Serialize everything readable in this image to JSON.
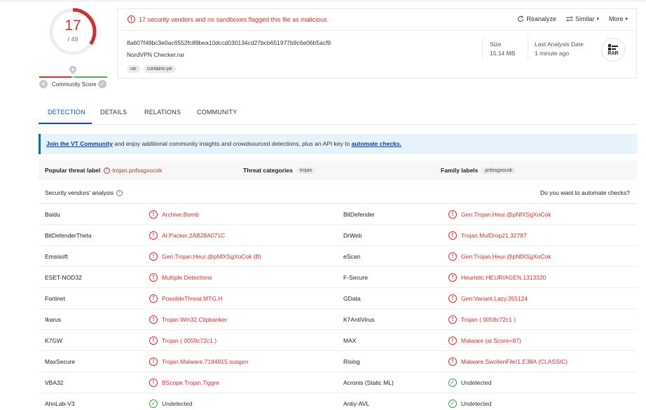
{
  "score": {
    "detections": "17",
    "total": "/ 49",
    "detected_fraction": 0.347
  },
  "community": {
    "label": "Community Score"
  },
  "file": {
    "alert": "17 security vendors and no sandboxes flagged this file as malicious",
    "hash": "8a607f49bc3e0ac6552fc89bea10dccd030134cd27bcb651977b9c6e06b5acf9",
    "name": "NordVPN Checker.rar",
    "tags": [
      "rar",
      "contains-pe"
    ],
    "size_label": "Size",
    "size_value": "15.14 MB",
    "last_label": "Last Analysis Date",
    "last_value": "1 minute ago",
    "type_icon_text": "RAR"
  },
  "actions": {
    "reanalyze": "Reanalyze",
    "similar": "Similar",
    "more": "More"
  },
  "tabs": [
    "DETECTION",
    "DETAILS",
    "RELATIONS",
    "COMMUNITY"
  ],
  "banner": {
    "link1": "Join the VT Community",
    "middle": " and enjoy additional community insights and crowdsourced detections, plus an API key to ",
    "link2": "automate checks."
  },
  "threat": {
    "popular_label": "Popular threat label",
    "popular_value": "trojan.pnfxsgxocok",
    "categories_label": "Threat categories",
    "categories_value": "trojan",
    "family_label": "Family labels",
    "family_value": "pnfxsgxocok"
  },
  "analysis": {
    "title": "Security vendors' analysis",
    "automate_q": "Do you want to automate checks?"
  },
  "vendors": [
    {
      "left_name": "Baidu",
      "left_result": "Archive.Bomb",
      "left_status": "malicious",
      "right_name": "BitDefender",
      "right_result": "Gen:Trojan.Heur.@pNfXSgXoCok",
      "right_status": "malicious"
    },
    {
      "left_name": "BitDefenderTheta",
      "left_result": "AI:Packer.2AB28A071C",
      "left_status": "malicious",
      "right_name": "DrWeb",
      "right_result": "Trojan.MulDrop21.32787",
      "right_status": "malicious"
    },
    {
      "left_name": "Emsisoft",
      "left_result": "Gen:Trojan.Heur.@pNfXSgXoCok (B)",
      "left_status": "malicious",
      "right_name": "eScan",
      "right_result": "Gen:Trojan.Heur.@pNfXSgXoCok",
      "right_status": "malicious"
    },
    {
      "left_name": "ESET-NOD32",
      "left_result": "Multiple Detections",
      "left_status": "malicious",
      "right_name": "F-Secure",
      "right_result": "Heuristic.HEUR/AGEN.1313320",
      "right_status": "malicious"
    },
    {
      "left_name": "Fortinet",
      "left_result": "PossibleThreat.MTG.H",
      "left_status": "malicious",
      "right_name": "GData",
      "right_result": "Gen:Variant.Lazy.355124",
      "right_status": "malicious"
    },
    {
      "left_name": "Ikarus",
      "left_result": "Trojan.Win32.Clipbanker",
      "left_status": "malicious",
      "right_name": "K7AntiVirus",
      "right_result": "Trojan ( 0059c72c1 )",
      "right_status": "malicious"
    },
    {
      "left_name": "K7GW",
      "left_result": "Trojan ( 0059c72c1 )",
      "left_status": "malicious",
      "right_name": "MAX",
      "right_result": "Malware (ai Score=87)",
      "right_status": "malicious"
    },
    {
      "left_name": "MaxSecure",
      "left_result": "Trojan.Malware.7184915.susgen",
      "left_status": "malicious",
      "right_name": "Rising",
      "right_result": "Malware.SwollenFile!1.E38A (CLASSIC)",
      "right_status": "malicious"
    },
    {
      "left_name": "VBA32",
      "left_result": "BScope.Trojan.Tiggre",
      "left_status": "malicious",
      "right_name": "Acronis (Static ML)",
      "right_result": "Undetected",
      "right_status": "undetected"
    },
    {
      "left_name": "AhnLab-V3",
      "left_result": "Undetected",
      "left_status": "undetected",
      "right_name": "Antiy-AVL",
      "right_result": "Undetected",
      "right_status": "undetected"
    }
  ],
  "colors": {
    "malicious": "#d32f2f",
    "undetected": "#43a047",
    "accent": "#0b4dda"
  }
}
